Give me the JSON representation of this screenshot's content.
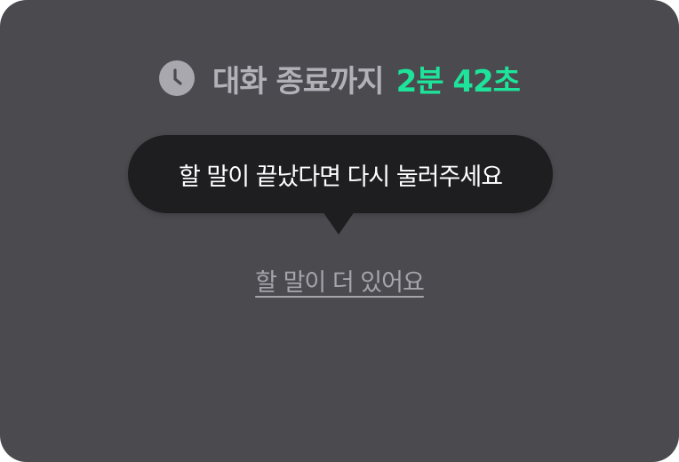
{
  "timer": {
    "label": "대화 종료까지",
    "remaining": "2분 42초",
    "icon": "clock-icon"
  },
  "tooltip": {
    "text": "할 말이 끝났다면 다시 눌러주세요"
  },
  "more_link": {
    "label": "할 말이 더 있어요"
  },
  "colors": {
    "panel_bg": "#4b4a4f",
    "accent": "#1ee39a",
    "tooltip_bg": "#1e1e21",
    "muted_text": "#b2b1b7"
  }
}
